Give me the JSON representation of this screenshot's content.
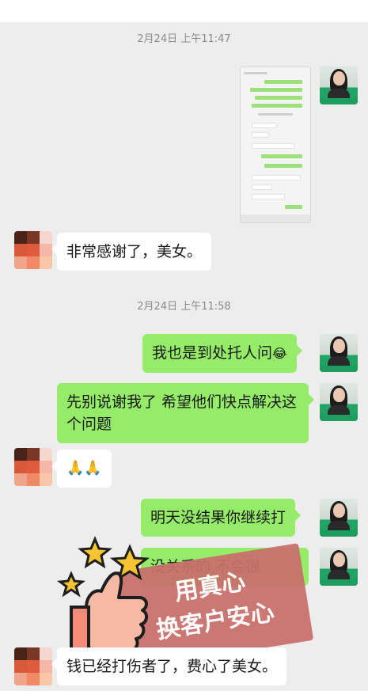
{
  "timestamps": [
    "2月24日 上午11:47",
    "2月24日 上午11:58"
  ],
  "messages": {
    "thanks_beauty": "非常感谢了，美女。",
    "asking_around": "我也是到处托人问",
    "asking_around_emoji": "😂",
    "dont_thank": "先别说谢我了 希望他们快点解决这个问题",
    "praying_emoji": "🙏🙏",
    "call_again": "明天没结果你继续打",
    "no_worries": "没关系的 不会很",
    "money_paid": "钱已经打伤者了，费心了美女。"
  },
  "stamp": {
    "line1": "用真心",
    "line2": "换客户安心"
  },
  "colors": {
    "outgoing_bubble": "#95ec69",
    "incoming_bubble": "#ffffff",
    "background": "#ededed",
    "stamp": "#c9706c"
  },
  "icons": {
    "sticker": "thumbs-up-with-stars"
  }
}
